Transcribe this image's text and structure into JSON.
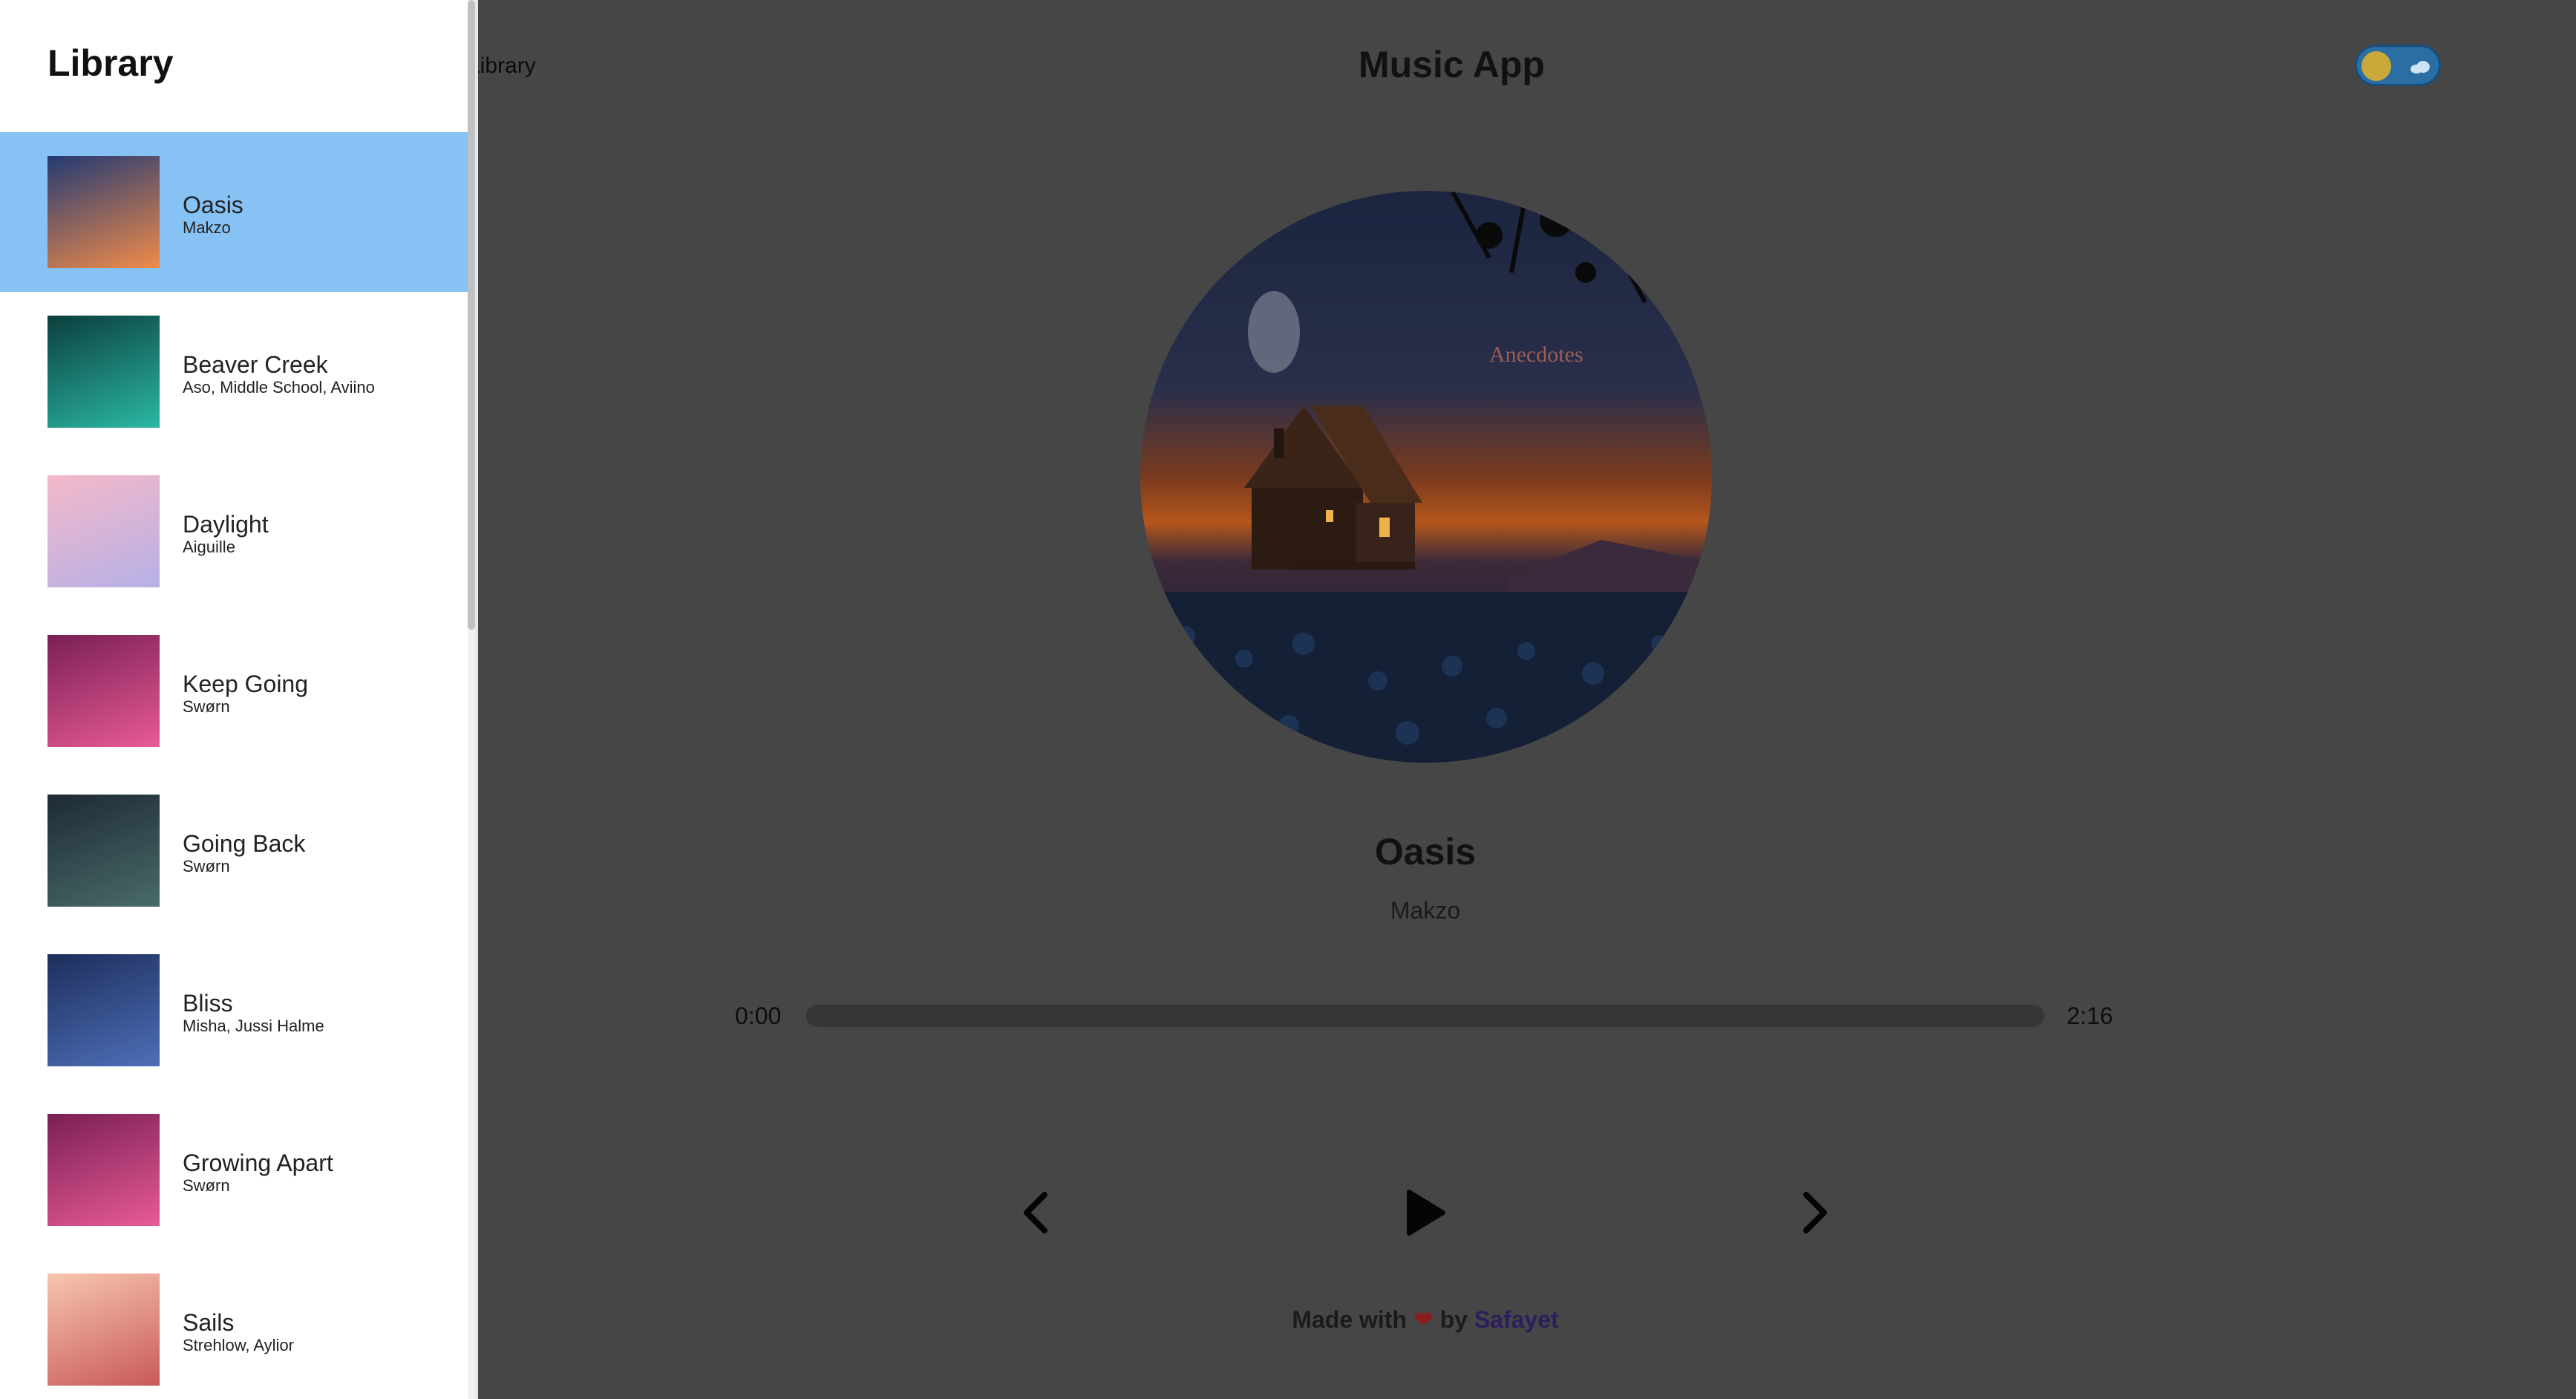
{
  "nav": {
    "library_label": "Library"
  },
  "app": {
    "title": "Music App"
  },
  "now_playing": {
    "title": "Oasis",
    "artist": "Makzo",
    "current_time": "0:00",
    "duration": "2:16",
    "progress": 0,
    "art_text": "Anecdotes"
  },
  "footer": {
    "made_with": "Made with",
    "by": "by",
    "author": "Safayet"
  },
  "library": {
    "heading": "Library",
    "songs": [
      {
        "title": "Oasis",
        "artist": "Makzo",
        "active": true,
        "colors": [
          "#233a73",
          "#f08b4a"
        ]
      },
      {
        "title": "Beaver Creek",
        "artist": "Aso, Middle School, Aviino",
        "active": false,
        "colors": [
          "#0b3f3d",
          "#2bb8a4"
        ]
      },
      {
        "title": "Daylight",
        "artist": "Aiguille",
        "active": false,
        "colors": [
          "#f4b9c9",
          "#b6b0e6"
        ]
      },
      {
        "title": "Keep Going",
        "artist": "Swørn",
        "active": false,
        "colors": [
          "#7a2052",
          "#e85a98"
        ]
      },
      {
        "title": "Going Back",
        "artist": "Swørn",
        "active": false,
        "colors": [
          "#1d2a33",
          "#4a6b6a"
        ]
      },
      {
        "title": "Bliss",
        "artist": "Misha, Jussi Halme",
        "active": false,
        "colors": [
          "#1e2e5c",
          "#4d6fb8"
        ]
      },
      {
        "title": "Growing Apart",
        "artist": "Swørn",
        "active": false,
        "colors": [
          "#7a2052",
          "#e85a98"
        ]
      },
      {
        "title": "Sails",
        "artist": "Strehlow, Aylior",
        "active": false,
        "colors": [
          "#f7c6b0",
          "#c95a5a"
        ]
      }
    ]
  },
  "theme": {
    "accent": "#87c2f5",
    "backdrop": "#464646",
    "heart": "#8a1d1d"
  },
  "icons": {
    "prev": "chevron-left-icon",
    "play": "play-icon",
    "next": "chevron-right-icon",
    "nav": "music-note-icon",
    "toggle": "theme-toggle"
  }
}
